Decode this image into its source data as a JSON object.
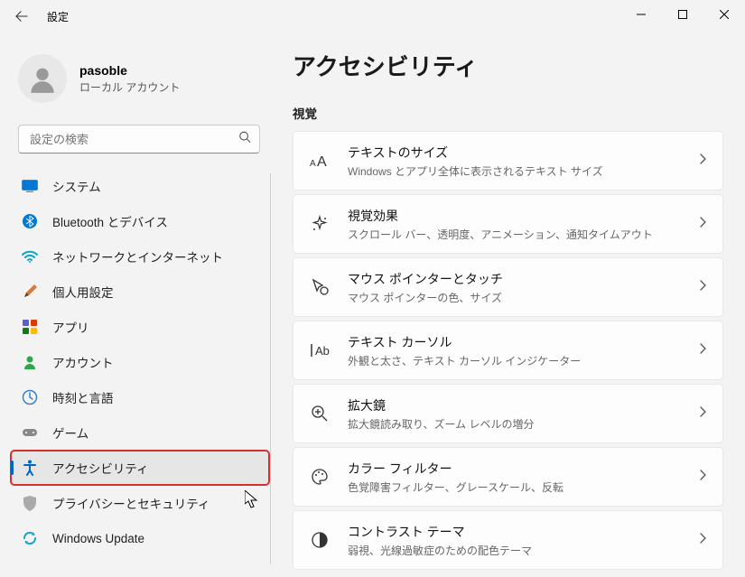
{
  "window": {
    "title": "設定"
  },
  "user": {
    "name": "pasoble",
    "accountType": "ローカル アカウント"
  },
  "search": {
    "placeholder": "設定の検索"
  },
  "nav": [
    {
      "key": "system",
      "label": "システム"
    },
    {
      "key": "bluetooth",
      "label": "Bluetooth とデバイス"
    },
    {
      "key": "network",
      "label": "ネットワークとインターネット"
    },
    {
      "key": "personalization",
      "label": "個人用設定"
    },
    {
      "key": "apps",
      "label": "アプリ"
    },
    {
      "key": "accounts",
      "label": "アカウント"
    },
    {
      "key": "time",
      "label": "時刻と言語"
    },
    {
      "key": "gaming",
      "label": "ゲーム"
    },
    {
      "key": "accessibility",
      "label": "アクセシビリティ"
    },
    {
      "key": "privacy",
      "label": "プライバシーとセキュリティ"
    },
    {
      "key": "update",
      "label": "Windows Update"
    }
  ],
  "page": {
    "title": "アクセシビリティ",
    "section": "視覚"
  },
  "cards": [
    {
      "title": "テキストのサイズ",
      "sub": "Windows とアプリ全体に表示されるテキスト サイズ"
    },
    {
      "title": "視覚効果",
      "sub": "スクロール バー、透明度、アニメーション、通知タイムアウト"
    },
    {
      "title": "マウス ポインターとタッチ",
      "sub": "マウス ポインターの色、サイズ"
    },
    {
      "title": "テキスト カーソル",
      "sub": "外観と太さ、テキスト カーソル インジケーター"
    },
    {
      "title": "拡大鏡",
      "sub": "拡大鏡読み取り、ズーム レベルの増分"
    },
    {
      "title": "カラー フィルター",
      "sub": "色覚障害フィルター、グレースケール、反転"
    },
    {
      "title": "コントラスト テーマ",
      "sub": "弱視、光線過敏症のための配色テーマ"
    }
  ]
}
